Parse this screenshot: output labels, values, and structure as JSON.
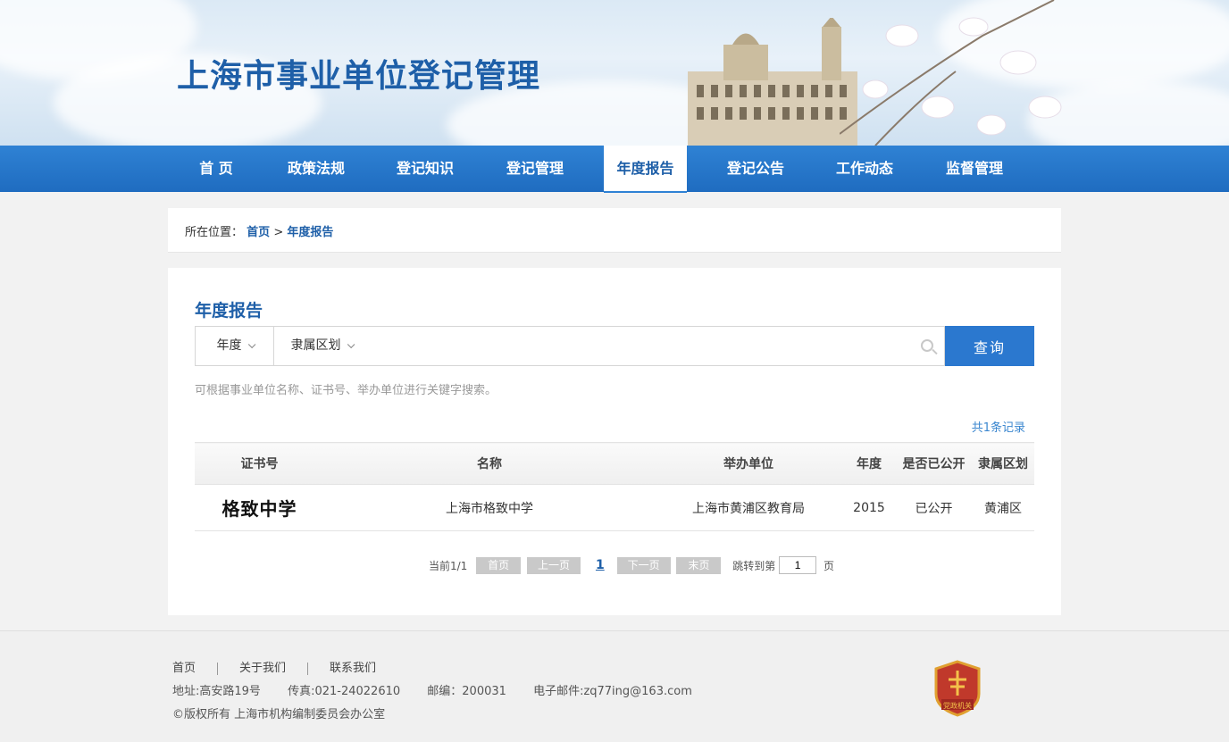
{
  "header": {
    "site_title": "上海市事业单位登记管理"
  },
  "nav": {
    "items": [
      {
        "label": "首  页"
      },
      {
        "label": "政策法规"
      },
      {
        "label": "登记知识"
      },
      {
        "label": "登记管理"
      },
      {
        "label": "年度报告"
      },
      {
        "label": "登记公告"
      },
      {
        "label": "工作动态"
      },
      {
        "label": "监督管理"
      }
    ],
    "active": "年度报告"
  },
  "breadcrumb": {
    "prefix": "所在位置：",
    "home": "首页",
    "sep": ">",
    "current": "年度报告"
  },
  "main": {
    "title": "年度报告",
    "search": {
      "year_label": "年度",
      "district_label": "隶属区划",
      "input_value": "",
      "query_button": "查询",
      "hint": "可根据事业单位名称、证书号、举办单位进行关键字搜索。"
    },
    "count_text": "共1条记录",
    "table": {
      "headers": [
        "证书号",
        "名称",
        "举办单位",
        "年度",
        "是否已公开",
        "隶属区划"
      ],
      "rows": [
        {
          "cert": "格致中学",
          "name": "上海市格致中学",
          "sponsor": "上海市黄浦区教育局",
          "year": "2015",
          "public": "已公开",
          "district": "黄浦区"
        }
      ]
    },
    "pager": {
      "current_text": "当前1/1",
      "first": "首页",
      "prev": "上一页",
      "page": "1",
      "next": "下一页",
      "last": "末页",
      "jump_prefix": "跳转到第",
      "jump_value": "1",
      "jump_suffix": "页"
    }
  },
  "footer": {
    "links": [
      "首页",
      "关于我们",
      "联系我们"
    ],
    "address": "地址:高安路19号",
    "fax": "传真:021-24022610",
    "postcode": "邮编：200031",
    "email": "电子邮件:zq77ing@163.com",
    "copyright": "©版权所有 上海市机构编制委员会办公室",
    "badge_text": "党政机关"
  },
  "colors": {
    "primary": "#2b78cf",
    "title_blue": "#1e5fa8",
    "public_green": "#3aa832"
  }
}
